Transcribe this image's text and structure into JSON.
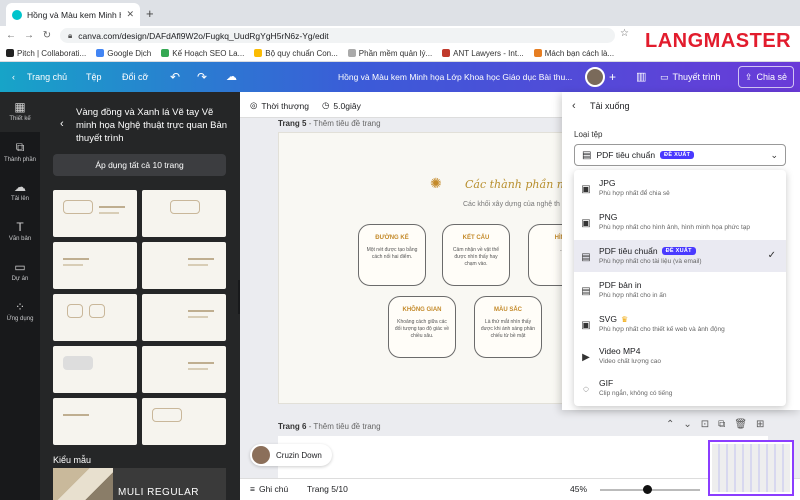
{
  "browser": {
    "tab_title": "Hồng và Màu kem Minh họa Lớ",
    "url": "canva.com/design/DAFdAfl9W2o/Fugkq_UudRgYgH5rN6z-Yg/edit",
    "bookmarks": [
      "Pitch | Collaborati...",
      "Google Dịch",
      "Kế Hoạch SEO La...",
      "Bộ quy chuẩn Con...",
      "Phần mềm quản lý...",
      "ANT Lawyers - Int...",
      "Mách bạn cách là..."
    ]
  },
  "watermark": "LANGMASTER",
  "header": {
    "home": "Trang chủ",
    "file": "Tệp",
    "resize": "Đổi cỡ",
    "doc_title": "Hồng và Màu kem Minh họa Lớp Khoa học Giáo dục Bài thu...",
    "present": "Thuyết trình",
    "share": "Chia sẻ"
  },
  "rail": [
    {
      "label": "Thiết kế",
      "icon": "layout-icon"
    },
    {
      "label": "Thành phần",
      "icon": "elements-icon"
    },
    {
      "label": "Tải lên",
      "icon": "upload-icon"
    },
    {
      "label": "Văn bản",
      "icon": "text-icon"
    },
    {
      "label": "Dự án",
      "icon": "folder-icon"
    },
    {
      "label": "Ứng dụng",
      "icon": "apps-icon"
    }
  ],
  "panel": {
    "title": "Vàng đồng và Xanh lá Vẽ tay Vẽ minh họa Nghệ thuật trực quan Bản thuyết trình",
    "apply_all": "Áp dụng tất cả 10 trang",
    "styles_label": "Kiểu mẫu",
    "font_card": "MULI REGULAR"
  },
  "toolbar": {
    "animate": "Thời thượng",
    "duration": "5.0giây"
  },
  "pages": {
    "page5_label": "Trang 5",
    "page5_sub": "- Thêm tiêu đề trang",
    "page6_label": "Trang 6",
    "page6_sub": "- Thêm tiêu đề trang"
  },
  "slide": {
    "heading": "Các thành phần nghệ th",
    "subheading": "Các khối xây dựng của nghệ th",
    "cards": [
      {
        "title": "ĐƯỜNG KẺ",
        "body": "Một nét được tạo bằng cách nối hai điểm."
      },
      {
        "title": "KẾT CẤU",
        "body": "Cảm nhận về vật thể được nhìn thấy hay chạm vào."
      },
      {
        "title": "HÌNH",
        "body": "..."
      },
      {
        "title": "KHÔNG GIAN",
        "body": "Khoảng cách giữa các đối tượng tạo độ giác về chiều sâu."
      },
      {
        "title": "MÀU SẮC",
        "body": "Là thứ mắt nhìn thấy được khi ánh sáng phản chiếu từ bề mặt"
      }
    ]
  },
  "collaborator": "Cruzin Down",
  "status": {
    "notes": "Ghi chú",
    "page": "Trang 5/10",
    "zoom": "45%"
  },
  "download": {
    "title": "Tải xuống",
    "file_type_label": "Loại tệp",
    "selected": "PDF tiêu chuẩn",
    "badge": "ĐỀ XUẤT",
    "options": [
      {
        "name": "JPG",
        "desc": "Phù hợp nhất để chia sẻ",
        "icon": "image-icon"
      },
      {
        "name": "PNG",
        "desc": "Phù hợp nhất cho hình ảnh, hình minh họa phức tạp",
        "icon": "image-icon"
      },
      {
        "name": "PDF tiêu chuẩn",
        "desc": "Phù hợp nhất cho tài liệu (và email)",
        "icon": "document-icon",
        "badge": "ĐỀ XUẤT",
        "selected": true
      },
      {
        "name": "PDF bản in",
        "desc": "Phù hợp nhất cho in ấn",
        "icon": "document-icon"
      },
      {
        "name": "SVG",
        "desc": "Phù hợp nhất cho thiết kế web và ảnh động",
        "icon": "image-icon"
      },
      {
        "name": "Video MP4",
        "desc": "Video chất lượng cao",
        "icon": "video-icon"
      },
      {
        "name": "GIF",
        "desc": "Clip ngắn, không có tiếng",
        "icon": "gif-icon"
      }
    ]
  },
  "colors": {
    "header_start": "#17a4c8",
    "header_end": "#6a3ad8",
    "badge": "#4a3aff",
    "logo": "#e21c2d",
    "accent_gold": "#c48a2a"
  }
}
